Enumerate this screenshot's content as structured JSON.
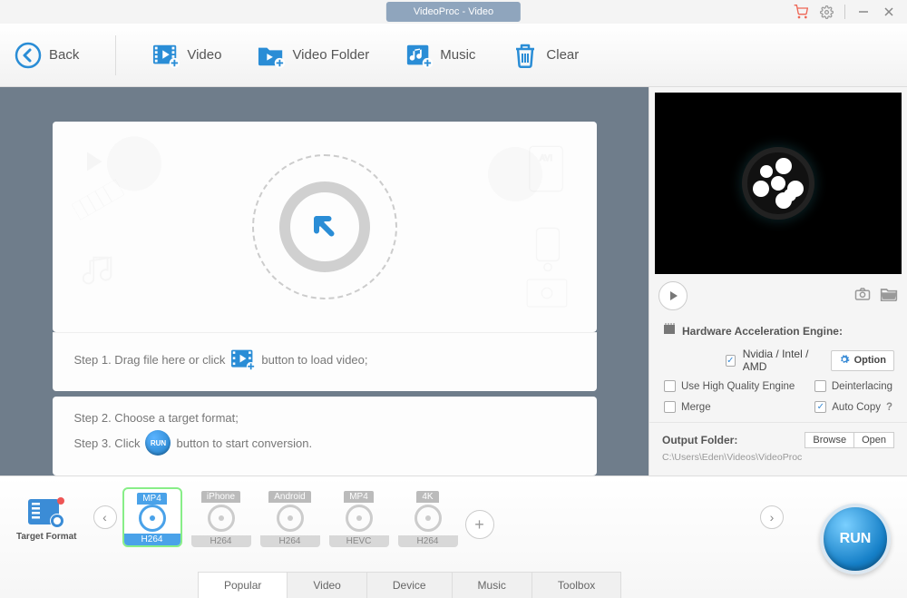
{
  "titlebar": {
    "title": "VideoProc - Video"
  },
  "toolbar": {
    "back": "Back",
    "video": "Video",
    "video_folder": "Video Folder",
    "music": "Music",
    "clear": "Clear"
  },
  "steps": {
    "s1a": "Step 1. Drag file here or click",
    "s1b": "button to load video;",
    "s2": "Step 2. Choose a target format;",
    "s3a": "Step 3. Click",
    "s3b": "button to start conversion.",
    "run_mini": "RUN"
  },
  "hw": {
    "title": "Hardware Acceleration Engine:",
    "gpu": "Nvidia / Intel / AMD",
    "option": "Option",
    "hq": "Use High Quality Engine",
    "deint": "Deinterlacing",
    "merge": "Merge",
    "autocopy": "Auto Copy",
    "q": "?"
  },
  "output": {
    "label": "Output Folder:",
    "browse": "Browse",
    "open": "Open",
    "path": "C:\\Users\\Eden\\Videos\\VideoProc"
  },
  "formats": {
    "target_label": "Target Format",
    "items": [
      {
        "top": "MP4",
        "bottom": "H264",
        "selected": true
      },
      {
        "top": "iPhone",
        "bottom": "H264",
        "selected": false
      },
      {
        "top": "Android",
        "bottom": "H264",
        "selected": false
      },
      {
        "top": "MP4",
        "bottom": "HEVC",
        "selected": false
      },
      {
        "top": "4K",
        "bottom": "H264",
        "selected": false
      }
    ]
  },
  "tabs": [
    "Popular",
    "Video",
    "Device",
    "Music",
    "Toolbox"
  ],
  "active_tab": 0,
  "run": "RUN"
}
